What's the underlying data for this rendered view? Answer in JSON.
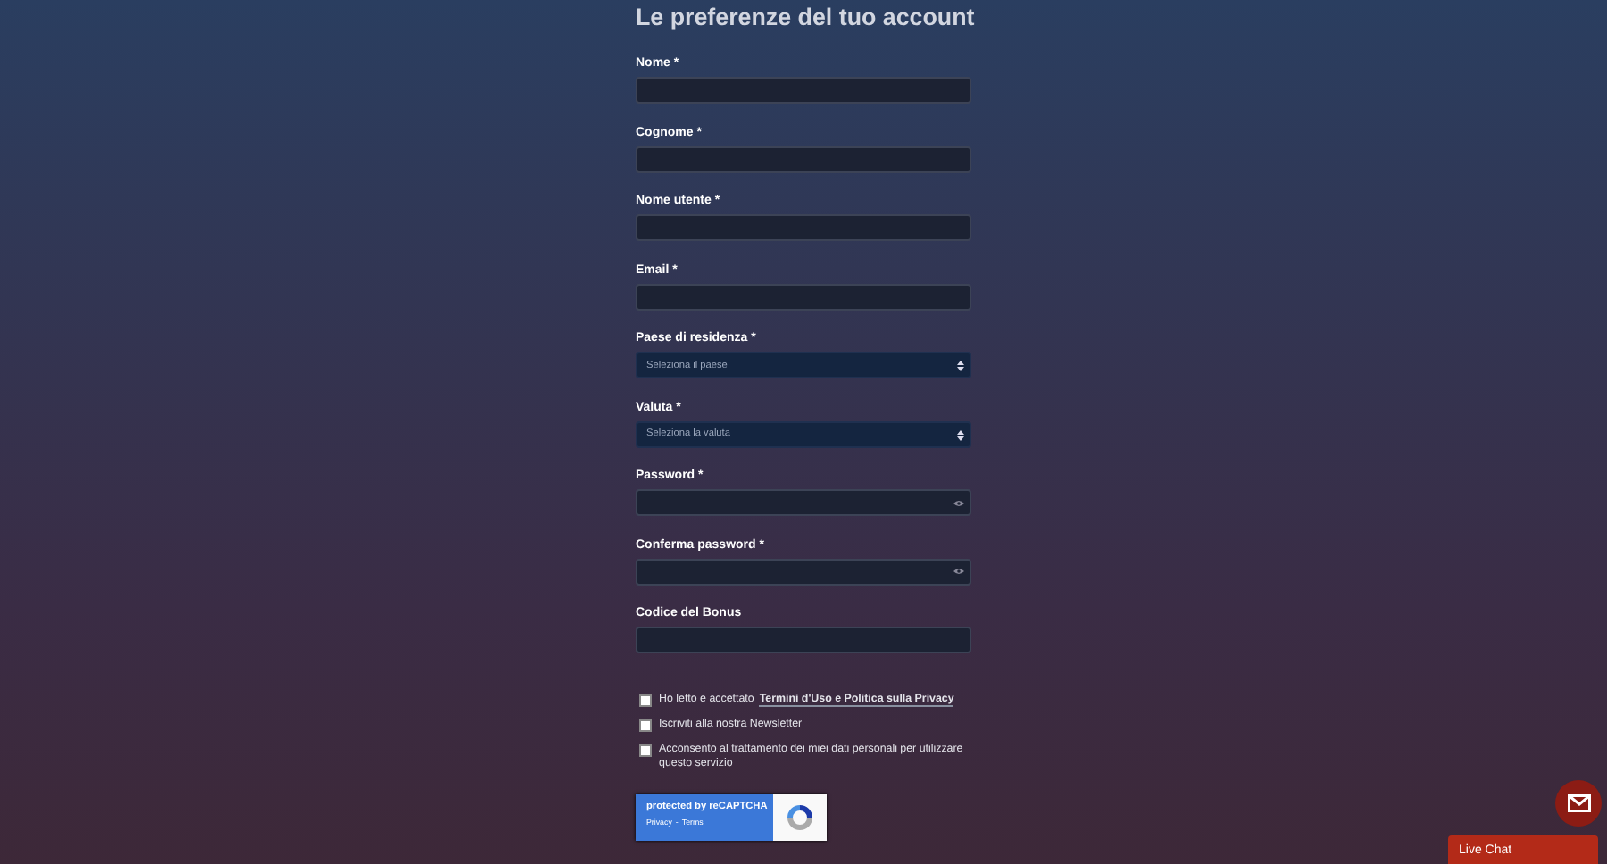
{
  "title": "Le preferenze del tuo account",
  "fields": [
    {
      "label": "Nome *",
      "kind": "text"
    },
    {
      "label": "Cognome *",
      "kind": "text"
    },
    {
      "label": "Nome utente *",
      "kind": "text"
    },
    {
      "label": "Email *",
      "kind": "text"
    },
    {
      "label": "Paese di residenza *",
      "kind": "select",
      "placeholder": "Seleziona il paese"
    },
    {
      "label": "Valuta *",
      "kind": "select",
      "placeholder": "Seleziona la valuta"
    },
    {
      "label": "Password *",
      "kind": "password"
    },
    {
      "label": "Conferma password *",
      "kind": "password"
    },
    {
      "label": "Codice del Bonus",
      "kind": "text"
    }
  ],
  "checkboxes": [
    {
      "text": "Ho letto e accettato",
      "link": "Termini d'Uso e Politica sulla Privacy",
      "checked": false
    },
    {
      "text": "Iscriviti alla nostra Newsletter",
      "checked": false
    },
    {
      "text": "Acconsento al trattamento dei miei dati personali per utilizzare questo servizio",
      "checked": false
    }
  ],
  "recaptcha": {
    "text": "protected by reCAPTCHA",
    "links": [
      "Privacy",
      "Terms"
    ],
    "separator": "-"
  },
  "live_chat": {
    "label": "Live Chat"
  }
}
